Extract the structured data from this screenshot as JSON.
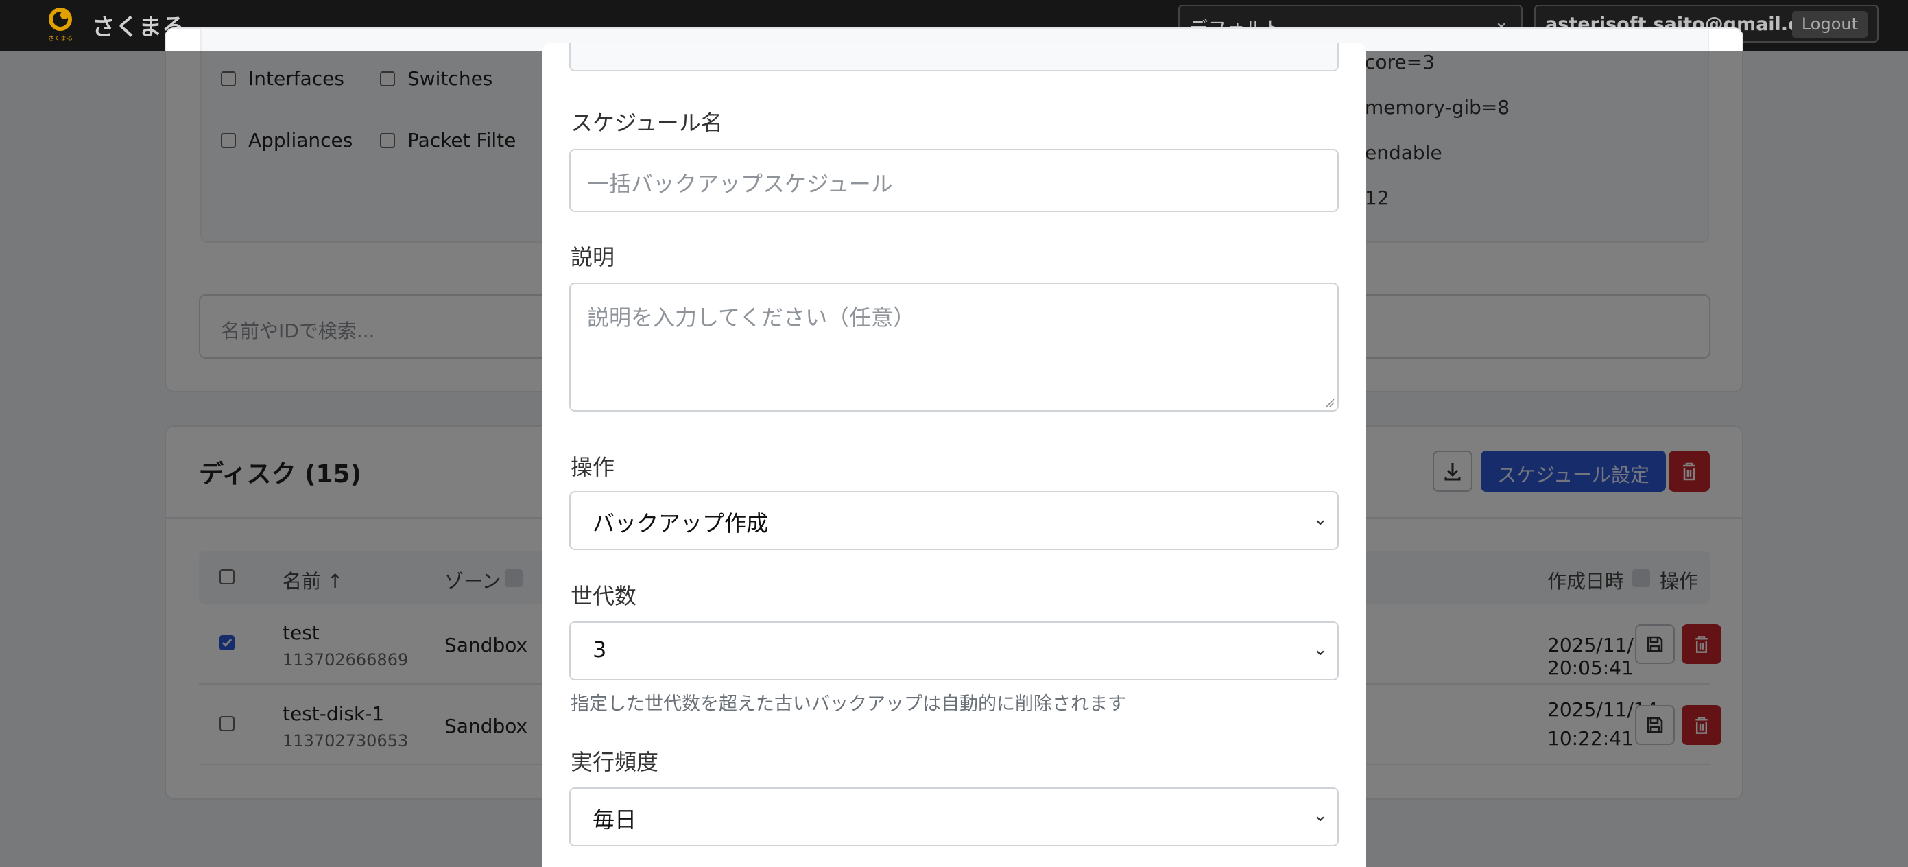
{
  "navbar": {
    "brand": "さくまる",
    "logo_caption": "さくまる",
    "context_select": "デフォルト",
    "user_email": "asterisoft.saito@gmail.com",
    "logout_label": "Logout"
  },
  "filters": {
    "items": [
      "Interfaces",
      "Switches",
      "Appliances",
      "Packet Filte"
    ],
    "right_lines": [
      "core=3",
      "memory-gib=8",
      "endable",
      "12"
    ]
  },
  "search": {
    "placeholder": "名前やIDで検索..."
  },
  "disks": {
    "title": "ディスク (15)",
    "schedule_button": "スケジュール設定",
    "columns": {
      "name": "名前 ↑",
      "zone": "ゾーン",
      "created": "作成日時",
      "actions": "操作"
    },
    "rows": [
      {
        "name": "test",
        "id": "113702666869",
        "zone": "Sandbox",
        "created": "2025/11/5 20:05:41",
        "checked": true
      },
      {
        "name": "test-disk-1",
        "id": "113702730653",
        "zone": "Sandbox",
        "created_line1": "2025/11/14",
        "created_line2": "10:22:41",
        "checked": false
      }
    ]
  },
  "modal": {
    "schedule_name_label": "スケジュール名",
    "schedule_name_placeholder": "一括バックアップスケジュール",
    "description_label": "説明",
    "description_placeholder": "説明を入力してください（任意）",
    "operation_label": "操作",
    "operation_value": "バックアップ作成",
    "generations_label": "世代数",
    "generations_value": "3",
    "generations_hint": "指定した世代数を超えた古いバックアップは自動的に削除されます",
    "frequency_label": "実行頻度",
    "frequency_value": "毎日"
  },
  "colors": {
    "primary": "#2e58d6",
    "danger": "#c6262c",
    "navbar": "#161616"
  }
}
